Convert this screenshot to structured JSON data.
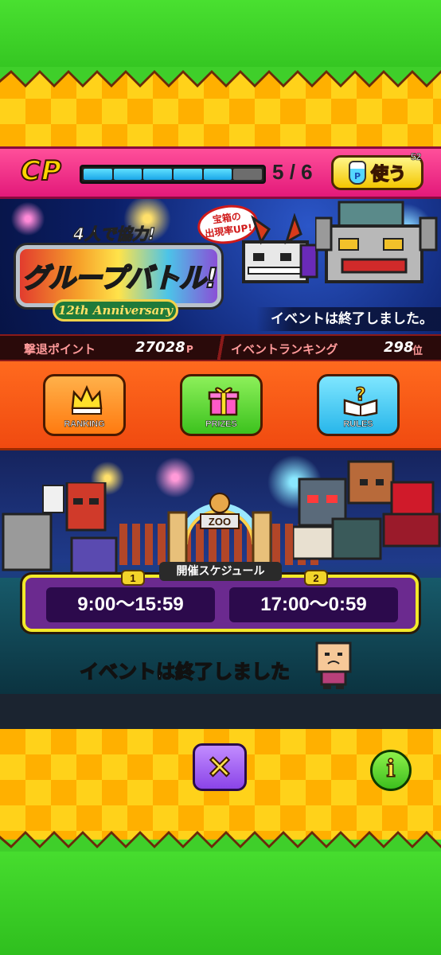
{
  "cp_bar": {
    "label": "CP",
    "current": "5",
    "separator": "/",
    "max": "6",
    "fill_fraction": 0.833,
    "use_button_label": "使う",
    "use_badge": "52"
  },
  "banner": {
    "subtitle": "4人で協力!",
    "title": "グループバトル!",
    "anniversary": "12th Anniversary",
    "rate_badge_line1": "宝箱の",
    "rate_badge_line2": "出現率UP!",
    "status": "イベントは終了しました。"
  },
  "scores": {
    "points_label": "撃退ポイント",
    "points_value": "27028",
    "points_unit": "P",
    "ranking_label": "イベントランキング",
    "ranking_value": "298",
    "ranking_unit": "位"
  },
  "menu": {
    "ranking": "RANKING",
    "prizes": "PRIZES",
    "rules": "RULES"
  },
  "schedule": {
    "label": "開催スケジュール",
    "slot1_number": "1",
    "slot1_time": "9:00〜15:59",
    "slot2_number": "2",
    "slot2_time": "17:00〜0:59"
  },
  "stage": {
    "gate_sign": "ZOO",
    "ended_message": "イベントは終了しました"
  },
  "footer": {
    "close_symbol": "×",
    "info_symbol": "i"
  },
  "colors": {
    "green": "#3fcf2a",
    "checker_orange": "#ffb000",
    "checker_yellow": "#ffd21a",
    "cp_pink": "#e3197a",
    "menu_orange": "#f04a10",
    "schedule_purple": "#6b2a8f"
  },
  "icons": [
    "crown-icon",
    "gift-icon",
    "rulebook-icon",
    "potion-icon",
    "close-icon",
    "info-icon"
  ]
}
